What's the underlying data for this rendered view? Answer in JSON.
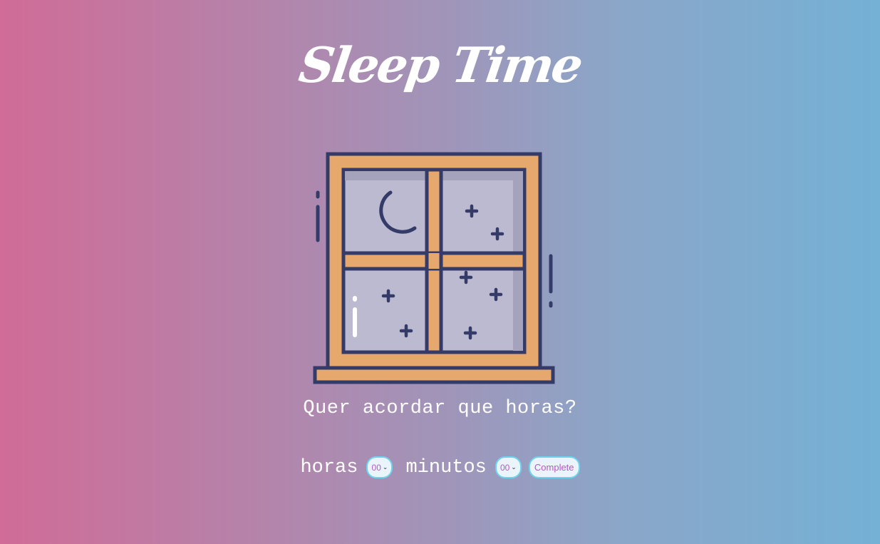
{
  "app": {
    "title": "Sleep Time"
  },
  "prompt": {
    "question": "Quer acordar que horas?"
  },
  "form": {
    "hours_label": "horas",
    "hours_value": "00",
    "minutes_label": "minutos",
    "minutes_value": "00",
    "submit_label": "Complete"
  },
  "colors": {
    "gradient_left": "#d06c97",
    "gradient_right": "#74b1d5",
    "window_frame": "#e6a86c",
    "outline": "#343b68",
    "glass": "#bbbad0",
    "control_border": "#6fd3ec",
    "control_text": "#b857c6"
  },
  "icons": {
    "window": "night-window-icon",
    "moon": "crescent-moon-icon",
    "star": "star-sparkle-icon",
    "dropdown": "chevron-down-icon"
  }
}
